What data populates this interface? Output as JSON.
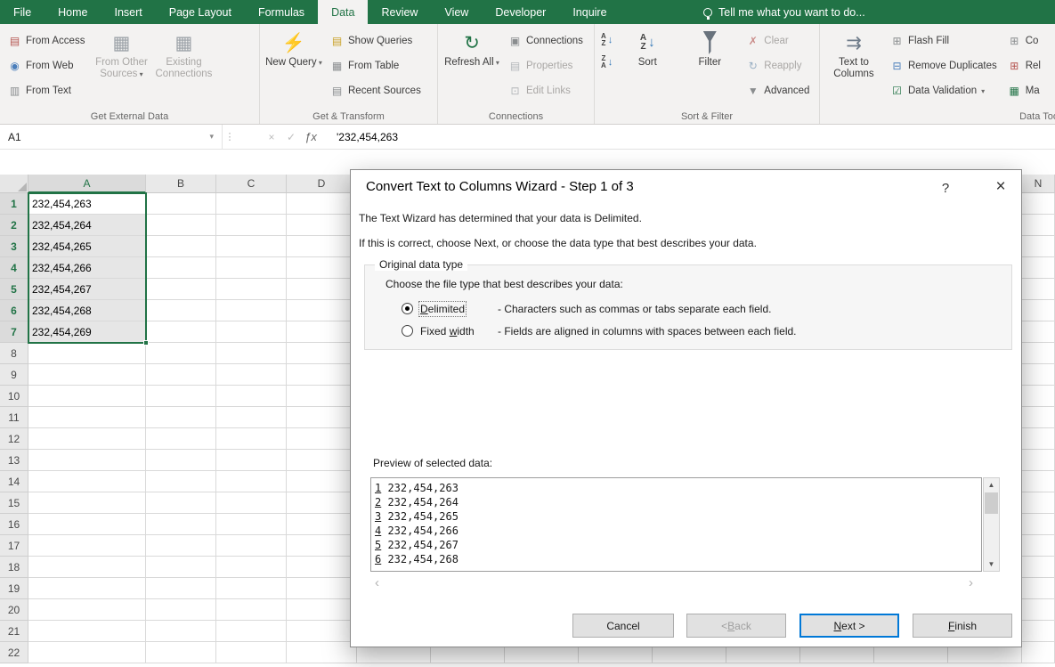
{
  "colors": {
    "excel_green": "#217346",
    "default_button_border": "#0078d7"
  },
  "tabs_bar": {
    "tabs": [
      {
        "label": "File",
        "active": false
      },
      {
        "label": "Home",
        "active": false
      },
      {
        "label": "Insert",
        "active": false
      },
      {
        "label": "Page Layout",
        "active": false
      },
      {
        "label": "Formulas",
        "active": false
      },
      {
        "label": "Data",
        "active": true
      },
      {
        "label": "Review",
        "active": false
      },
      {
        "label": "View",
        "active": false
      },
      {
        "label": "Developer",
        "active": false
      },
      {
        "label": "Inquire",
        "active": false
      }
    ],
    "tell_me": "Tell me what you want to do..."
  },
  "ribbon": {
    "groups": [
      {
        "label": "Get External Data",
        "blocks": [
          {
            "type": "stack",
            "items": [
              {
                "label": "From Access",
                "icon": "▤",
                "icon_color": "#b5534f",
                "icon_name": "access-database-icon"
              },
              {
                "label": "From Web",
                "icon": "◉",
                "icon_color": "#4a7ebb",
                "icon_name": "web-globe-icon"
              },
              {
                "label": "From Text",
                "icon": "▥",
                "icon_color": "#8a8d8f",
                "icon_name": "text-file-icon"
              }
            ]
          },
          {
            "type": "big",
            "items": [
              {
                "label": "From Other Sources",
                "icon": "▦",
                "icon_color": "#9aa0a6",
                "icon_name": "other-sources-icon",
                "disabled": true,
                "dropdown": true
              },
              {
                "label": "Existing Connections",
                "icon": "▦",
                "icon_color": "#9aa0a6",
                "icon_name": "existing-connections-icon",
                "disabled": true
              }
            ]
          }
        ]
      },
      {
        "label": "Get & Transform",
        "blocks": [
          {
            "type": "big",
            "items": [
              {
                "label": "New Query",
                "icon": "⚡",
                "icon_color": "#e2a33c",
                "icon_name": "new-query-icon",
                "dropdown": true
              }
            ]
          },
          {
            "type": "stack",
            "items": [
              {
                "label": "Show Queries",
                "icon": "▤",
                "icon_color": "#c9a227",
                "icon_name": "show-queries-icon"
              },
              {
                "label": "From Table",
                "icon": "▦",
                "icon_color": "#8a8d8f",
                "icon_name": "from-table-icon"
              },
              {
                "label": "Recent Sources",
                "icon": "▤",
                "icon_color": "#8a8d8f",
                "icon_name": "recent-sources-icon"
              }
            ]
          }
        ]
      },
      {
        "label": "Connections",
        "blocks": [
          {
            "type": "big",
            "items": [
              {
                "label": "Refresh All",
                "icon": "↻",
                "icon_color": "#217346",
                "icon_name": "refresh-all-icon",
                "dropdown": true
              }
            ]
          },
          {
            "type": "stack",
            "items": [
              {
                "label": "Connections",
                "icon": "▣",
                "icon_color": "#8a8d8f",
                "icon_name": "connections-icon"
              },
              {
                "label": "Properties",
                "icon": "▤",
                "icon_color": "#b3b7ba",
                "icon_name": "properties-icon",
                "disabled": true
              },
              {
                "label": "Edit Links",
                "icon": "⊡",
                "icon_color": "#b3b7ba",
                "icon_name": "edit-links-icon",
                "disabled": true
              }
            ]
          }
        ]
      },
      {
        "label": "Sort & Filter",
        "blocks": [
          {
            "type": "minis",
            "items": [
              {
                "name": "sort-a-to-z-button",
                "letters": "AZ",
                "arrow": "↓"
              },
              {
                "name": "sort-z-to-a-button",
                "letters": "ZA",
                "arrow": "↓"
              }
            ]
          },
          {
            "type": "big",
            "items": [
              {
                "label": "Sort",
                "icon_name": "sort-icon",
                "sorticon": true,
                "letters": "AZ",
                "arrow": "↓"
              },
              {
                "label": "Filter",
                "icon_name": "filter-funnel-icon",
                "funnel": true
              }
            ]
          },
          {
            "type": "stack",
            "items": [
              {
                "label": "Clear",
                "icon": "✗",
                "icon_color": "#c98a87",
                "icon_name": "clear-filter-icon",
                "disabled": true
              },
              {
                "label": "Reapply",
                "icon": "↻",
                "icon_color": "#9ab0c4",
                "icon_name": "reapply-filter-icon",
                "disabled": true
              },
              {
                "label": "Advanced",
                "icon": "▼",
                "icon_color": "#8a8d8f",
                "icon_name": "advanced-filter-icon"
              }
            ]
          }
        ]
      },
      {
        "label": "Data Tools",
        "blocks": [
          {
            "type": "big",
            "items": [
              {
                "label": "Text to Columns",
                "icon": "⇉",
                "icon_color": "#6f7c8a",
                "icon_name": "text-to-columns-icon"
              }
            ]
          },
          {
            "type": "stack",
            "items": [
              {
                "label": "Flash Fill",
                "icon": "⊞",
                "icon_color": "#8a8d8f",
                "icon_name": "flash-fill-icon"
              },
              {
                "label": "Remove Duplicates",
                "icon": "⊟",
                "icon_color": "#4a7ebb",
                "icon_name": "remove-duplicates-icon"
              },
              {
                "label": "Data Validation",
                "icon": "☑",
                "icon_color": "#217346",
                "icon_name": "data-validation-icon",
                "dropdown": true
              }
            ]
          },
          {
            "type": "stack",
            "items": [
              {
                "label": "Co",
                "icon": "⊞",
                "icon_color": "#8a8d8f",
                "icon_name": "consolidate-icon"
              },
              {
                "label": "Rel",
                "icon": "⊞",
                "icon_color": "#b5534f",
                "icon_name": "relationships-icon"
              },
              {
                "label": "Ma",
                "icon": "▦",
                "icon_color": "#217346",
                "icon_name": "manage-data-model-icon"
              }
            ]
          }
        ]
      }
    ]
  },
  "formula_bar": {
    "name_box": "A1",
    "dropdown_glyph": "▾",
    "splitter_glyph": "⋮",
    "cancel_glyph": "×",
    "enter_glyph": "✓",
    "fx_glyph": "ƒx",
    "value": "'232,454,263"
  },
  "grid": {
    "columns": [
      "A",
      "B",
      "C",
      "D"
    ],
    "far_column": "N",
    "selected_column": "A",
    "row_numbers": [
      "1",
      "2",
      "3",
      "4",
      "5",
      "6",
      "7",
      "8",
      "9",
      "10",
      "11",
      "12",
      "13",
      "14",
      "15",
      "16",
      "17",
      "18",
      "19",
      "20",
      "21",
      "22"
    ],
    "selected_row_count": 7,
    "cells_column_a": [
      "232,454,263",
      "232,454,264",
      "232,454,265",
      "232,454,266",
      "232,454,267",
      "232,454,268",
      "232,454,269"
    ]
  },
  "dialog": {
    "title": "Convert Text to Columns Wizard - Step 1 of 3",
    "help_glyph": "?",
    "close_glyph": "×",
    "intro_line1": "The Text Wizard has determined that your data is Delimited.",
    "intro_line2": "If this is correct, choose Next, or choose the data type that best describes your data.",
    "groupbox_label": "Original data type",
    "choose_label": "Choose the file type that best describes your data:",
    "radios": [
      {
        "label": "Delimited",
        "accel": 0,
        "desc": "- Characters such as commas or tabs separate each field.",
        "selected": true
      },
      {
        "label": "Fixed width",
        "accel": 6,
        "desc": "- Fields are aligned in columns with spaces between each field.",
        "selected": false
      }
    ],
    "preview_label": "Preview of selected data:",
    "preview_lines": [
      {
        "n": "1",
        "v": "232,454,263"
      },
      {
        "n": "2",
        "v": "232,454,264"
      },
      {
        "n": "3",
        "v": "232,454,265"
      },
      {
        "n": "4",
        "v": "232,454,266"
      },
      {
        "n": "5",
        "v": "232,454,267"
      },
      {
        "n": "6",
        "v": "232,454,268"
      }
    ],
    "scroll": {
      "up": "▲",
      "down": "▼",
      "left": "‹",
      "right": "›"
    },
    "buttons": [
      {
        "label": "Cancel",
        "name": "cancel-button"
      },
      {
        "label": "< Back",
        "name": "back-button",
        "accel": 2,
        "disabled": true
      },
      {
        "label": "Next >",
        "name": "next-button",
        "accel": 0,
        "default": true
      },
      {
        "label": "Finish",
        "name": "finish-button",
        "accel": 0
      }
    ]
  }
}
